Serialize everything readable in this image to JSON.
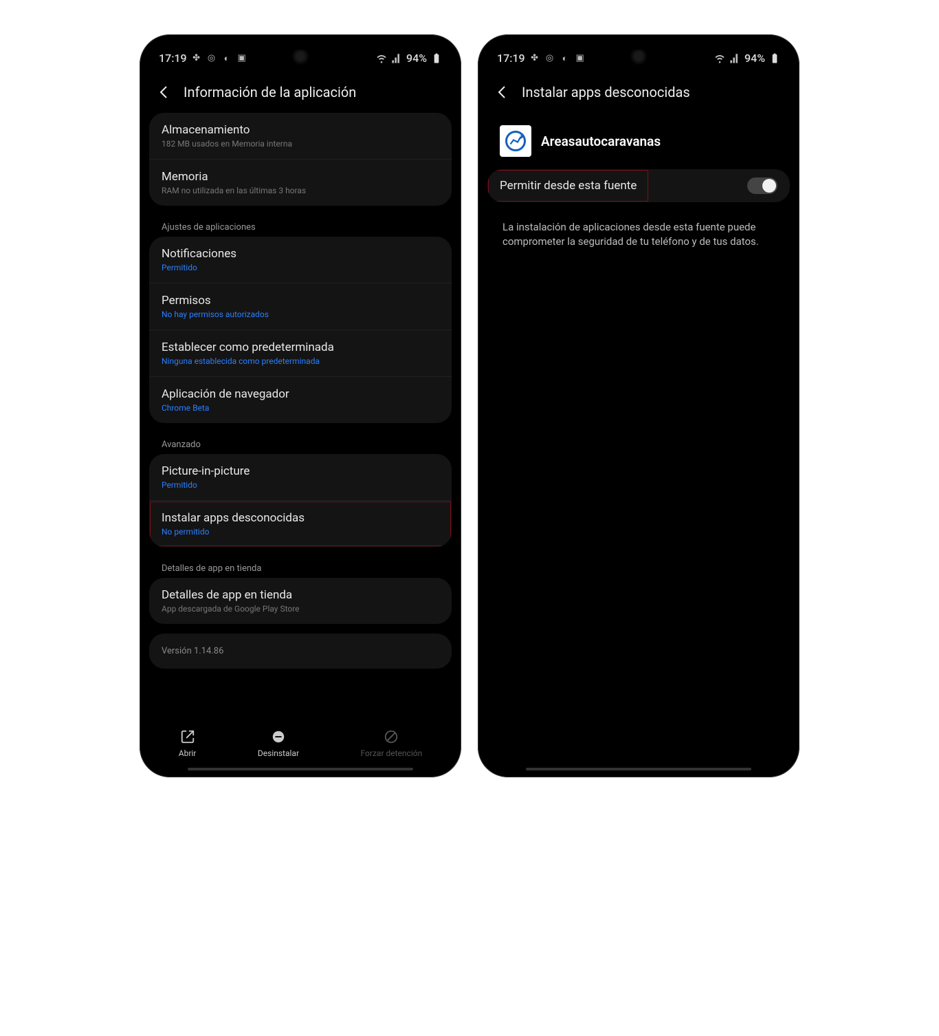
{
  "status": {
    "time": "17:19",
    "battery": "94%"
  },
  "screen1": {
    "title": "Información de la aplicación",
    "storage": {
      "title": "Almacenamiento",
      "sub": "182 MB usados en Memoria interna"
    },
    "memory": {
      "title": "Memoria",
      "sub": "RAM no utilizada en las últimas 3 horas"
    },
    "group_settings": "Ajustes de aplicaciones",
    "notif": {
      "title": "Notificaciones",
      "sub": "Permitido"
    },
    "perms": {
      "title": "Permisos",
      "sub": "No hay permisos autorizados"
    },
    "default": {
      "title": "Establecer como predeterminada",
      "sub": "Ninguna establecida como predeterminada"
    },
    "browser": {
      "title": "Aplicación de navegador",
      "sub": "Chrome Beta"
    },
    "group_adv": "Avanzado",
    "pip": {
      "title": "Picture-in-picture",
      "sub": "Permitido"
    },
    "unknown": {
      "title": "Instalar apps desconocidas",
      "sub": "No permitido"
    },
    "group_store": "Detalles de app en tienda",
    "store": {
      "title": "Detalles de app en tienda",
      "sub": "App descargada de Google Play Store"
    },
    "version": "Versión 1.14.86",
    "actions": {
      "open": "Abrir",
      "uninstall": "Desinstalar",
      "force": "Forzar detención"
    }
  },
  "screen2": {
    "title": "Instalar apps desconocidas",
    "appName": "Areasautocaravanas",
    "allow": "Permitir desde esta fuente",
    "desc": "La instalación de aplicaciones desde esta fuente puede comprometer la seguridad de tu teléfono y de tus datos."
  }
}
